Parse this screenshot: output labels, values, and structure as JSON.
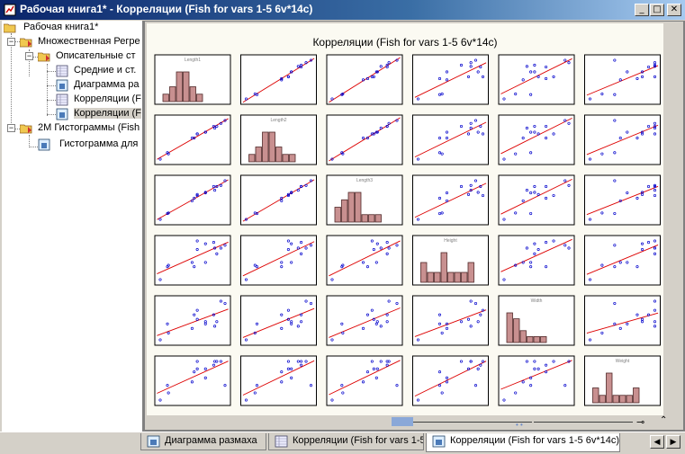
{
  "window": {
    "title": "Рабочая книга1* - Корреляции (Fish for vars 1-5 6v*14c)"
  },
  "tree": {
    "root": "Рабочая книга1*",
    "items": [
      {
        "label": "Множественная Регре"
      },
      {
        "label": "Описательные ст"
      },
      {
        "label": "Средние и ст."
      },
      {
        "label": "Диаграмма ра"
      },
      {
        "label": "Корреляции (F"
      },
      {
        "label": "Корреляции (F"
      },
      {
        "label": "2M Гистограммы (Fish"
      },
      {
        "label": "Гистограмма для"
      }
    ]
  },
  "graph": {
    "title": "Корреляции (Fish for vars 1-5 6v*14c)"
  },
  "tabs": [
    {
      "label": "Диаграмма размаха"
    },
    {
      "label": "Корреляции (Fish for vars 1-5)"
    },
    {
      "label": "Корреляции (Fish for vars 1-5 6v*14c)"
    }
  ],
  "chart_data": {
    "type": "scatter",
    "title": "Корреляции (Fish for vars 1-5 6v*14c)",
    "variables": [
      "Length1",
      "Length2",
      "Length3",
      "Height",
      "Width",
      "Weight"
    ],
    "n": 14,
    "colors": {
      "points": "#0000cc",
      "fit_line": "#dd0000",
      "bars": "#c89090"
    },
    "histograms": [
      [
        1,
        2,
        4,
        4,
        2,
        1
      ],
      [
        1,
        2,
        4,
        4,
        2,
        1,
        1
      ],
      [
        2,
        3,
        4,
        4,
        1,
        1,
        1
      ],
      [
        2,
        1,
        1,
        3,
        1,
        1,
        1,
        2
      ],
      [
        5,
        4,
        2,
        1,
        1,
        1
      ],
      [
        2,
        1,
        4,
        1,
        1,
        1,
        2
      ]
    ],
    "scatter_values": {
      "Length1": [
        23.2,
        24,
        23.9,
        26.3,
        26.5,
        26.8,
        26.8,
        27.6,
        27.6,
        28.5,
        28.4,
        28.7,
        29.1,
        29.5
      ],
      "Length2": [
        25.4,
        26.3,
        26.5,
        29,
        29,
        29.7,
        29.7,
        30,
        30,
        30.7,
        31,
        31,
        31.5,
        32
      ],
      "Length3": [
        30,
        31.2,
        31.1,
        33.5,
        34,
        34.7,
        34.5,
        35,
        35.1,
        35.5,
        36.2,
        36.2,
        36.4,
        37.3
      ],
      "Height": [
        11.5,
        12.5,
        12.4,
        12.7,
        12.4,
        13.6,
        14.2,
        12.7,
        14,
        13.7,
        14.1,
        13.3,
        13.7,
        13.9
      ],
      "Width": [
        4,
        4.3,
        4.7,
        4.5,
        5.1,
        4.9,
        5.3,
        4.7,
        4.8,
        4.6,
        5.1,
        4.8,
        5.7,
        5.6
      ],
      "Weight": [
        242,
        290,
        340,
        363,
        430,
        450,
        500,
        390,
        450,
        500,
        475,
        500,
        500,
        340
      ]
    }
  }
}
